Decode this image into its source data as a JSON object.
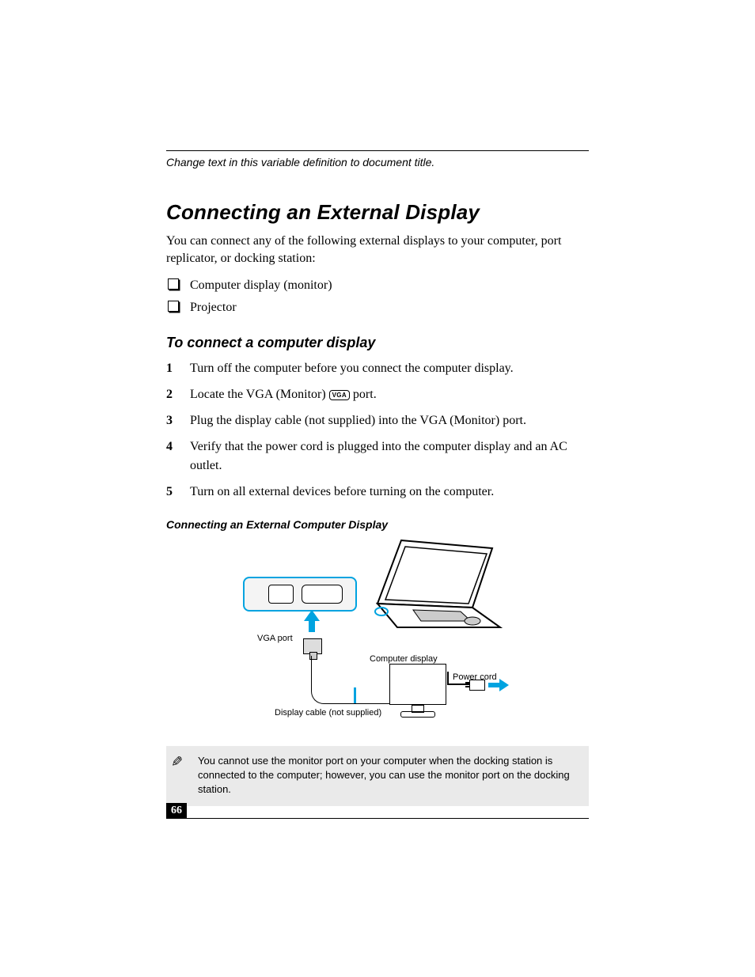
{
  "running_head": "Change text in this variable definition to document title.",
  "section_title": "Connecting an External Display",
  "intro": "You can connect any of the following external displays to your computer, port replicator, or docking station:",
  "bullets": [
    "Computer display (monitor)",
    "Projector"
  ],
  "subhead": "To connect a computer display",
  "steps": [
    {
      "num": "1",
      "text": "Turn off the computer before you connect the computer display."
    },
    {
      "num": "2",
      "text_before": "Locate the VGA (Monitor) ",
      "badge": "VGA",
      "text_after": " port."
    },
    {
      "num": "3",
      "text": "Plug the display cable (not supplied) into the VGA (Monitor) port."
    },
    {
      "num": "4",
      "text": "Verify that the power cord is plugged into the computer display and an AC outlet."
    },
    {
      "num": "5",
      "text": "Turn on all external devices before turning on the computer."
    }
  ],
  "figure_caption": "Connecting an External Computer Display",
  "figure_labels": {
    "vga_port": "VGA port",
    "computer_display": "Computer display",
    "power_cord": "Power cord",
    "display_cable": "Display cable (not supplied)"
  },
  "note_text": "You cannot use the monitor port on your computer when the docking station is connected to the computer; however, you can use the monitor port on the docking station.",
  "page_number": "66"
}
